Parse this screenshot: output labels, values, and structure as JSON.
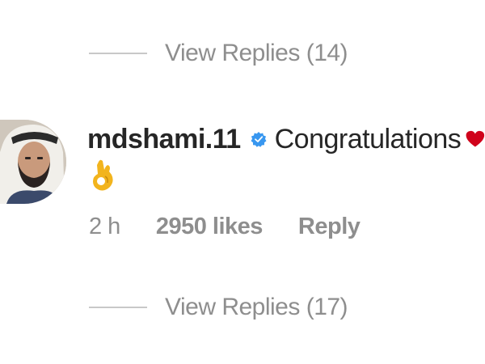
{
  "replies_top": {
    "label": "View Replies (14)"
  },
  "comment": {
    "username": "mdshami.11",
    "text": "Congratulations",
    "verified_icon": "verified-badge-icon",
    "emojis": [
      "red-heart-icon",
      "ok-hand-icon"
    ],
    "time": "2 h",
    "likes": "2950 likes",
    "reply_label": "Reply"
  },
  "replies_bottom": {
    "label": "View Replies (17)"
  },
  "colors": {
    "text_primary": "#262626",
    "text_secondary": "#8e8e8e",
    "verified_blue": "#3897f0",
    "heart_red": "#d0021b"
  }
}
